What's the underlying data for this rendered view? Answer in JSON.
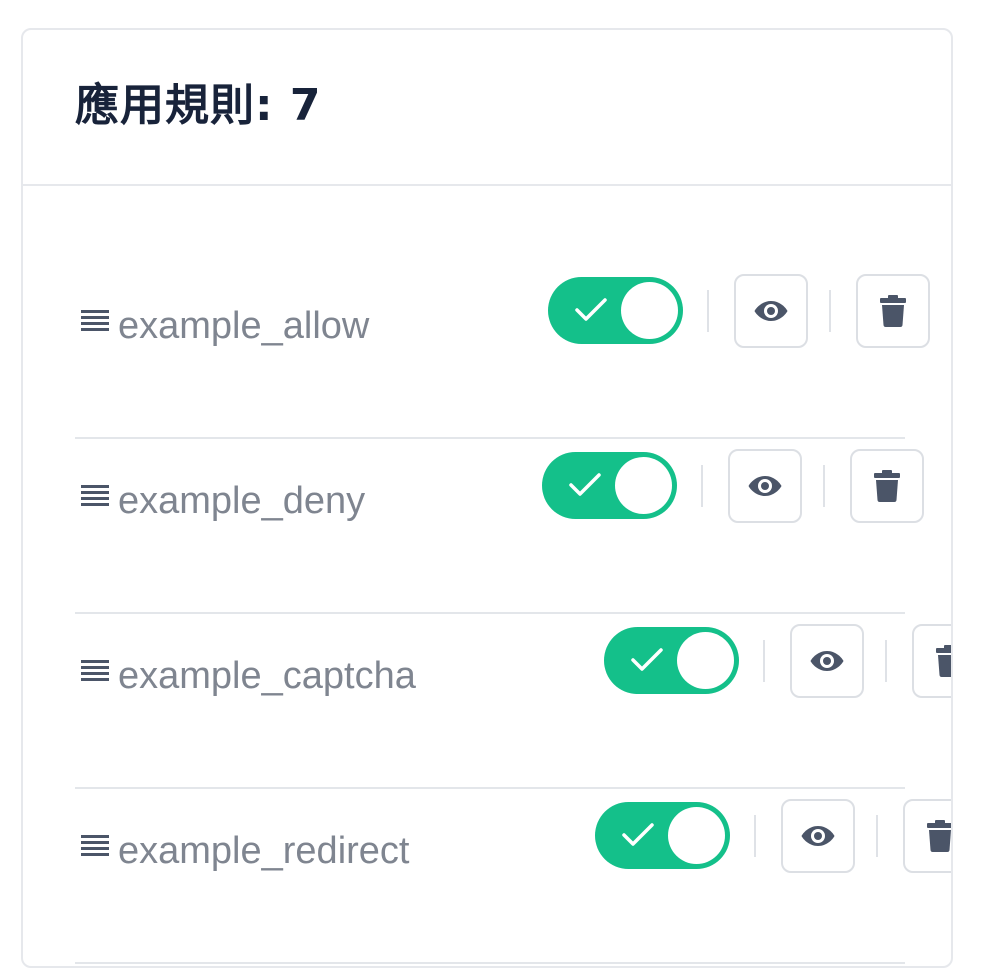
{
  "header": {
    "title": "應用規則: 7"
  },
  "colors": {
    "toggle_on": "#14c08a",
    "title_text": "#18233a",
    "rule_text": "#7f8590",
    "icon": "#4b5568",
    "border": "#e6e8ec"
  },
  "rules": [
    {
      "name": "example_allow",
      "enabled": true,
      "icons": [
        "drag-handle-icon",
        "check-icon",
        "eye-icon",
        "trash-icon"
      ]
    },
    {
      "name": "example_deny",
      "enabled": true,
      "icons": [
        "drag-handle-icon",
        "check-icon",
        "eye-icon",
        "trash-icon"
      ]
    },
    {
      "name": "example_captcha",
      "enabled": true,
      "icons": [
        "drag-handle-icon",
        "check-icon",
        "eye-icon",
        "trash-icon"
      ]
    },
    {
      "name": "example_redirect",
      "enabled": true,
      "icons": [
        "drag-handle-icon",
        "check-icon",
        "eye-icon",
        "trash-icon"
      ]
    }
  ]
}
